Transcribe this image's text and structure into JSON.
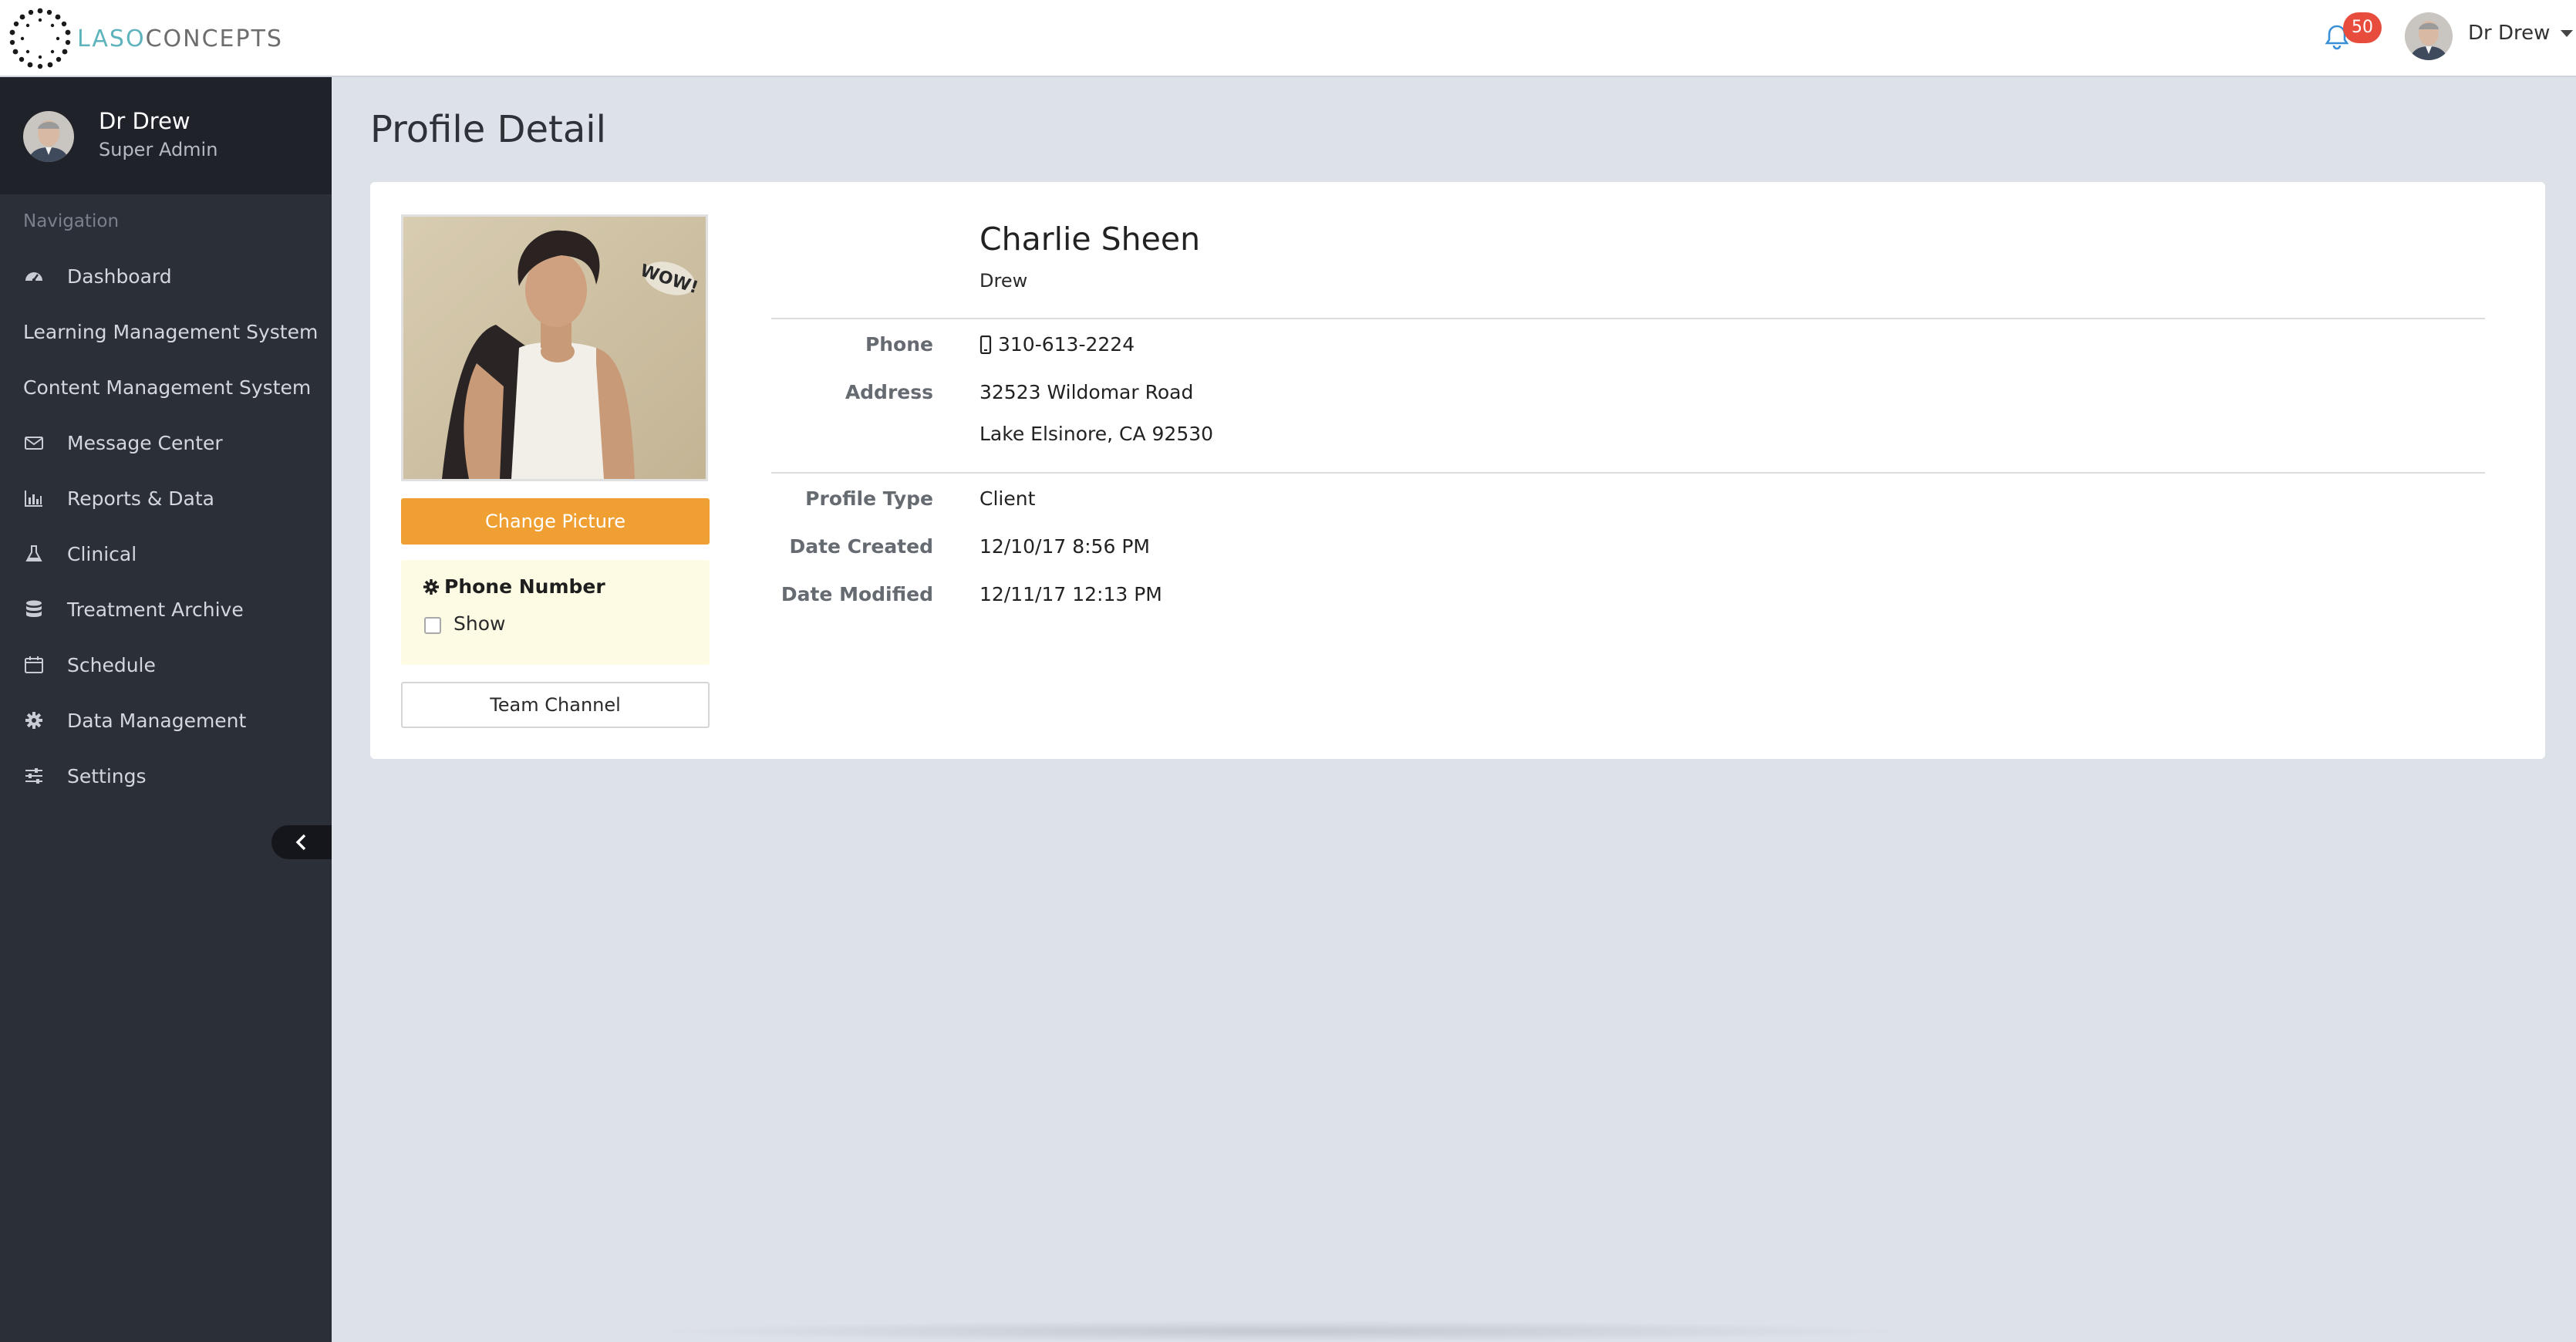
{
  "app": {
    "logo_primary": "LASO",
    "logo_secondary": "CONCEPTS",
    "accent_color": "#5eb4bd"
  },
  "topbar": {
    "notifications_count": "50",
    "user_name": "Dr Drew",
    "bell_icon": "bell-icon",
    "badge_color": "#e74c3c"
  },
  "sidebar": {
    "user_name": "Dr Drew",
    "user_role": "Super Admin",
    "nav_title": "Navigation",
    "items": [
      {
        "label": "Dashboard",
        "icon": "dashboard-icon"
      },
      {
        "label": "Learning Management System",
        "icon": ""
      },
      {
        "label": "Content Management System",
        "icon": ""
      },
      {
        "label": "Message Center",
        "icon": "envelope-icon"
      },
      {
        "label": "Reports & Data",
        "icon": "bar-chart-icon"
      },
      {
        "label": "Clinical",
        "icon": "flask-icon"
      },
      {
        "label": "Treatment Archive",
        "icon": "database-icon"
      },
      {
        "label": "Schedule",
        "icon": "calendar-icon"
      },
      {
        "label": "Data Management",
        "icon": "gear-icon"
      },
      {
        "label": "Settings",
        "icon": "sliders-icon"
      }
    ]
  },
  "page": {
    "title": "Profile Detail"
  },
  "profile": {
    "name": "Charlie Sheen",
    "nickname": "Drew",
    "change_picture_label": "Change Picture",
    "phone_panel_title": "Phone Number",
    "phone_show_label": "Show",
    "phone_show_checked": false,
    "team_channel_label": "Team Channel",
    "fields": {
      "phone_label": "Phone",
      "phone_value": "310-613-2224",
      "address_label": "Address",
      "address_line1": "32523 Wildomar Road",
      "address_line2": "Lake Elsinore, CA 92530",
      "profile_type_label": "Profile Type",
      "profile_type_value": "Client",
      "date_created_label": "Date Created",
      "date_created_value": "12/10/17 8:56 PM",
      "date_modified_label": "Date Modified",
      "date_modified_value": "12/11/17 12:13 PM"
    },
    "photo_sticker_text": "WOW!"
  },
  "colors": {
    "sidebar_bg": "#2b2f38",
    "button_orange": "#f0a033",
    "panel_yellow": "#fefbe4"
  }
}
